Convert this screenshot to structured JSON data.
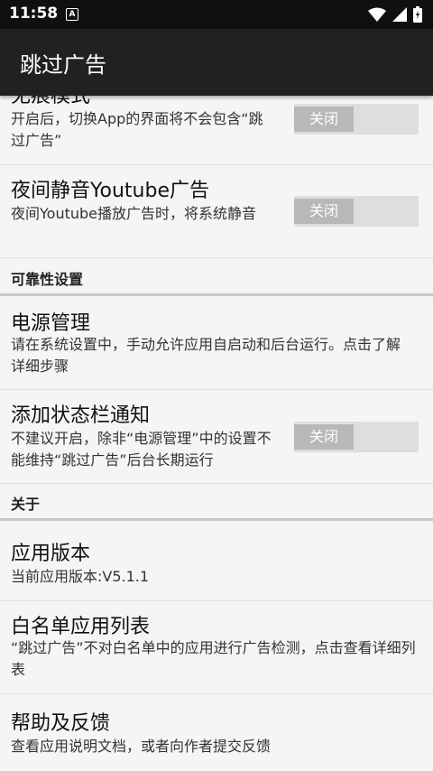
{
  "status_bar": {
    "time": "11:58",
    "notification_icon": "A"
  },
  "app_bar": {
    "title": "跳过广告"
  },
  "rows": [
    {
      "title": "无痕模式",
      "desc": "开启后，切换App的界面将不会包含“跳过广告”",
      "toggle": "关闭"
    },
    {
      "title": "夜间静音Youtube广告",
      "desc": "夜间Youtube播放广告时，将系统静音",
      "toggle": "关闭"
    }
  ],
  "section_reliability": "可靠性设置",
  "rows_reliability": [
    {
      "title": "电源管理",
      "desc": "请在系统设置中，手动允许应用自启动和后台运行。点击了解详细步骤"
    },
    {
      "title": "添加状态栏通知",
      "desc": "不建议开启，除非“电源管理”中的设置不能维持“跳过广告”后台长期运行",
      "toggle": "关闭"
    }
  ],
  "section_about": "关于",
  "rows_about": [
    {
      "title": "应用版本",
      "desc": "当前应用版本:V5.1.1"
    },
    {
      "title": "白名单应用列表",
      "desc": "“跳过广告”不对白名单中的应用进行广告检测，点击查看详细列表"
    },
    {
      "title": "帮助及反馈",
      "desc": "查看应用说明文档，或者向作者提交反馈"
    }
  ]
}
